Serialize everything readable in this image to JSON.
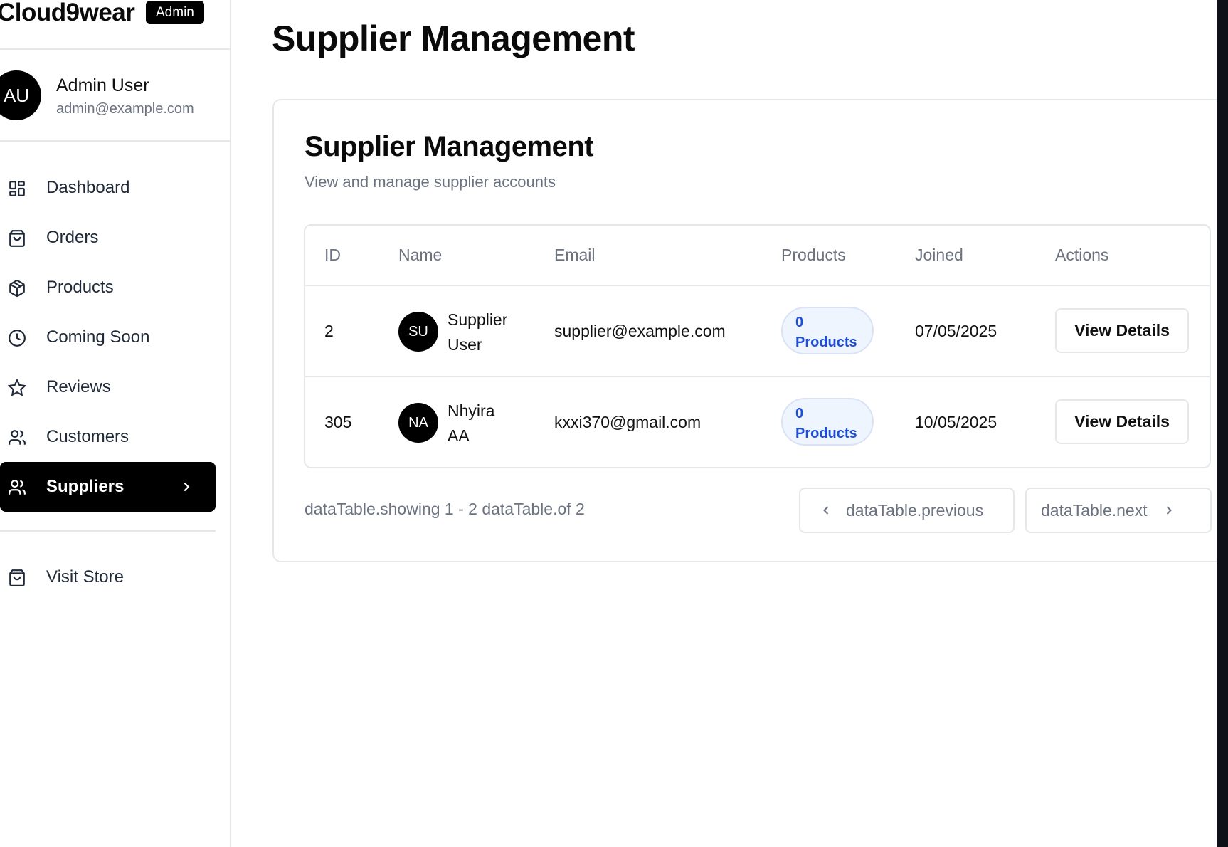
{
  "brand": {
    "name": "Cloud9wear",
    "badge": "Admin"
  },
  "user": {
    "initials": "AU",
    "name": "Admin User",
    "email": "admin@example.com"
  },
  "nav": {
    "items": [
      {
        "label": "Dashboard",
        "icon": "dashboard-icon"
      },
      {
        "label": "Orders",
        "icon": "shopping-bag-icon"
      },
      {
        "label": "Products",
        "icon": "package-icon"
      },
      {
        "label": "Coming Soon",
        "icon": "clock-icon"
      },
      {
        "label": "Reviews",
        "icon": "star-icon"
      },
      {
        "label": "Customers",
        "icon": "users-icon"
      },
      {
        "label": "Suppliers",
        "icon": "users-icon",
        "active": true
      }
    ],
    "store": {
      "label": "Visit Store",
      "icon": "shopping-bag-icon"
    }
  },
  "page": {
    "title": "Supplier Management"
  },
  "card": {
    "title": "Supplier Management",
    "subtitle": "View and manage supplier accounts"
  },
  "table": {
    "headers": [
      "ID",
      "Name",
      "Email",
      "Products",
      "Joined",
      "Actions"
    ],
    "rows": [
      {
        "id": "2",
        "initials": "SU",
        "name_line1": "Supplier",
        "name_line2": "User",
        "email": "supplier@example.com",
        "products_count": "0",
        "products_label": "Products",
        "joined": "07/05/2025",
        "action": "View Details"
      },
      {
        "id": "305",
        "initials": "NA",
        "name_line1": "Nhyira",
        "name_line2": "AA",
        "email": "kxxi370@gmail.com",
        "products_count": "0",
        "products_label": "Products",
        "joined": "10/05/2025",
        "action": "View Details"
      }
    ]
  },
  "pagination": {
    "info": "dataTable.showing 1 - 2 dataTable.of 2",
    "previous": "dataTable.previous",
    "next": "dataTable.next"
  },
  "colors": {
    "accent": "#000000",
    "pill_text": "#1d4ed8",
    "pill_bg": "#eff5ff",
    "muted": "#6b7280",
    "border": "#e5e7eb"
  }
}
